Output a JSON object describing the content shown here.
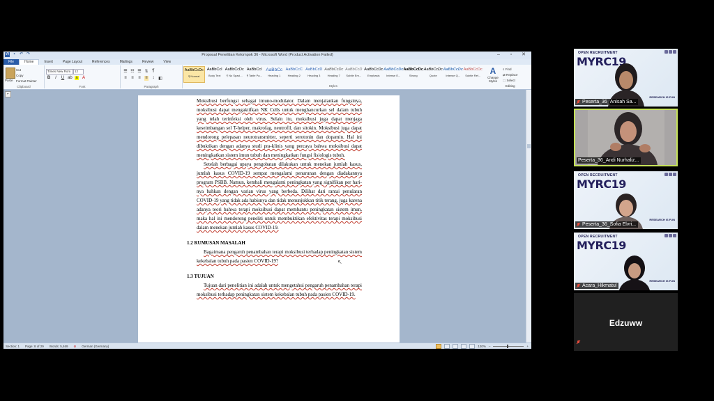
{
  "word": {
    "title": "Proposal Penelitian Kelompok 36  -  Microsoft Word (Product Activation Failed)",
    "tabs": [
      "File",
      "Home",
      "Insert",
      "Page Layout",
      "References",
      "Mailings",
      "Review",
      "View"
    ],
    "active_tab": "Home",
    "clipboard": {
      "paste": "Paste",
      "cut": "Cut",
      "copy": "Copy",
      "format_painter": "Format Painter",
      "label": "Clipboard"
    },
    "font": {
      "name": "Times New Rom",
      "size": "12",
      "label": "Font"
    },
    "paragraph": {
      "label": "Paragraph"
    },
    "styles": {
      "label": "Styles",
      "items": [
        {
          "sample": "AaBbCcDc",
          "name": "¶ Normal"
        },
        {
          "sample": "AaBbCcI",
          "name": "Body Text"
        },
        {
          "sample": "AaBbCcDc",
          "name": "¶ No Spaci..."
        },
        {
          "sample": "AaBbCcI",
          "name": "¶ Table Pa..."
        },
        {
          "sample": "AaBbCc",
          "name": "Heading 1"
        },
        {
          "sample": "AaBbCcC",
          "name": "Heading 2"
        },
        {
          "sample": "AaBbCcD",
          "name": "Heading 3"
        },
        {
          "sample": "AaBbCcDc",
          "name": "Heading 7"
        },
        {
          "sample": "AaBbCcD",
          "name": "Subtle Em..."
        },
        {
          "sample": "AaBbCcDc",
          "name": "Emphasis"
        },
        {
          "sample": "AaBbCcDc",
          "name": "Intense E..."
        },
        {
          "sample": "AaBbCcDc",
          "name": "Strong"
        },
        {
          "sample": "AaBbCcDc",
          "name": "Quote"
        },
        {
          "sample": "AaBbCcDc",
          "name": "Intense Q..."
        },
        {
          "sample": "AaBbCcDc",
          "name": "Subtle Ref..."
        }
      ]
    },
    "change_styles": "Change Styles",
    "editing": {
      "find": "Find",
      "replace": "Replace",
      "select": "Select",
      "label": "Editing"
    },
    "document": {
      "para1": "Moksibusi berfungsi sebagai imuno-modulator. Dalam menjalankan fungsinya, moksibusi dapat mengaktifkan NK Cells untuk menghancurkan sel dalam tubuh yang telah terinfeksi oleh virus. Selain itu, moksibusi juga dapat menjaga keseimbangan sel T-helper, makrofag, neutrofil, dan sitokin. Moksibusi juga dapat mendorong pelepasan neurotransmitter, seperti serotonin dan dopamin. Hal ini dibuktikan dengan adanya studi pra-klinis yang percaya bahwa moksibusi dapat meningkatkan sistem imun tubuh dan meningkatkan fungsi fisiologis tubuh.",
      "para2": "Setelah berbagai upaya pengobatan dilakukan untuk menekan jumlah kasus, jumlah kasus COVID-19 sempat mengalami penurunan dengan diadakannya program PSBB. Namun, kembali mengalami peningkatan yang signifikan per hari-nya bahkan dengan varian virus yang berbeda. Dilihat dari rantai penularan COVID-19 yang tidak ada habisnya dan tidak menunjukkan titik terang, juga karena adanya teori bahwa terapi moksibusi dapat membantu peningkatan sistem imun, maka hal ini mendorong peneliti untuk membuktikan efektivitas terapi moksibusi dalam menekan jumlah kasus COVID-19.",
      "heading1": "1.2  RUMUSAN MASALAH",
      "para3": "Bagaimana pengaruh penambahan terapi moksibusi terhadap peningkatan sistem kekebalan tubuh pada pasien COVID-19?",
      "heading2": "1.3  TUJUAN",
      "para4": "Tujuan dari penelitian ini adalah untuk mengetahui pengaruh penambahan terapi moksibusi terhadap peningkatan sistem kekebalan tubuh pada pasien COVID-19."
    },
    "status": {
      "section": "Section: 1",
      "page": "Page: 8 of 29",
      "words": "Words: 5,469",
      "language": "German (Germany)",
      "zoom": "120%"
    }
  },
  "meeting": {
    "banner": {
      "open": "OPEN RECRUITMENT",
      "brand": "MYRC19",
      "tagline": "RESEARCH IS FUN"
    },
    "participants": [
      {
        "name": "Peserta_36_Anisah Sa...",
        "muted": true
      },
      {
        "name": "Peserta_36_Andi Nurhaliz...",
        "muted": false,
        "active": true
      },
      {
        "name": "Peserta_36_Sofia Elvri...",
        "muted": true
      },
      {
        "name": "Acara_Hikmatul",
        "muted": true
      },
      {
        "name": "Edzuww",
        "muted": true,
        "video_off": true
      }
    ],
    "active_border_color": "#c6e25a"
  }
}
